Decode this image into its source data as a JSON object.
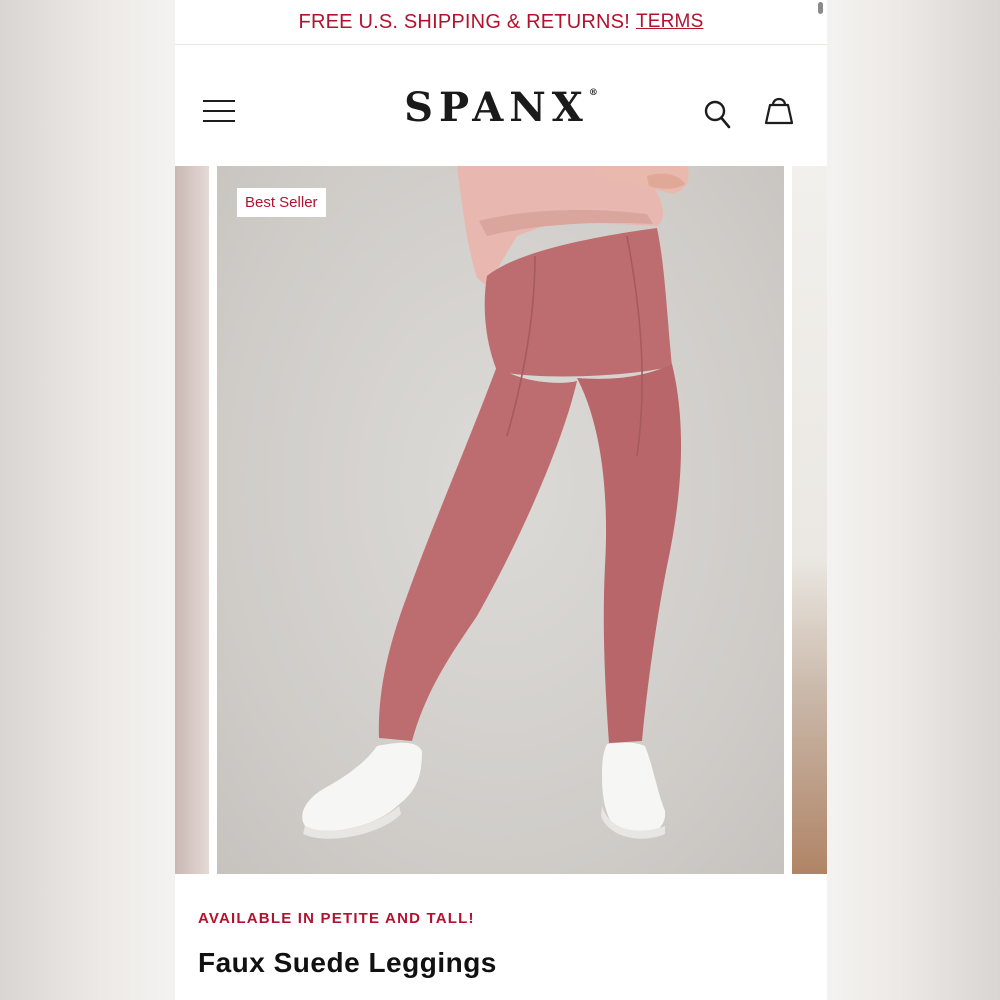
{
  "promo": {
    "text": "FREE U.S. SHIPPING & RETURNS!",
    "link": "TERMS"
  },
  "header": {
    "logo": "SPANX",
    "logo_mark": "®",
    "menu_icon": "hamburger-menu-icon",
    "search_icon": "search-icon",
    "bag_icon": "shopping-bag-icon"
  },
  "carousel": {
    "badge": "Best Seller"
  },
  "product": {
    "callout": "AVAILABLE IN PETITE AND TALL!",
    "title": "Faux Suede Leggings"
  },
  "colors": {
    "accent": "#b3122e",
    "legging": "#bd6d70",
    "top": "#e8b8b0",
    "background": "#d0cdc9"
  }
}
